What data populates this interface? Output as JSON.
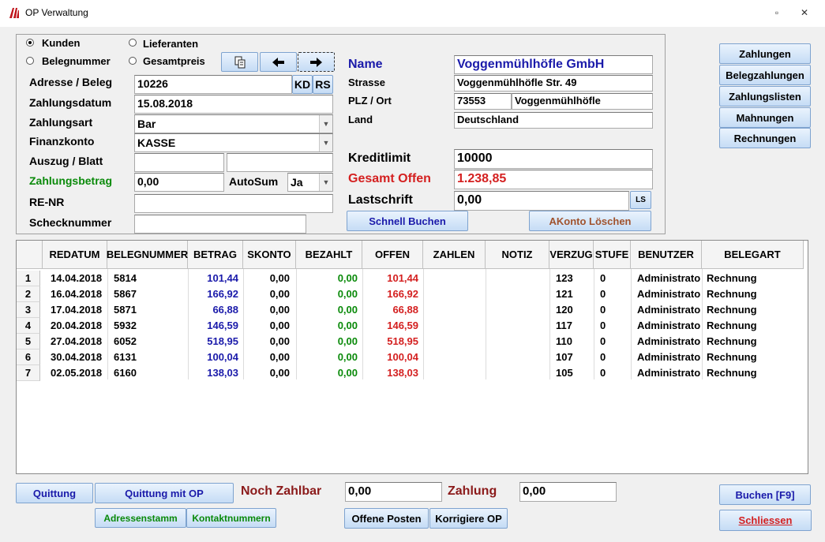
{
  "window": {
    "title": "OP Verwaltung",
    "restore_glyph": "▫",
    "close_glyph": "✕"
  },
  "mode": {
    "kunden": "Kunden",
    "lieferanten": "Lieferanten",
    "belegnummer": "Belegnummer",
    "gesamtpreis": "Gesamtpreis",
    "selected": "Kunden"
  },
  "form": {
    "adresse_label": "Adresse / Beleg",
    "adresse_value": "10226",
    "kd": "KD",
    "rs": "RS",
    "zahlungsdatum_label": "Zahlungsdatum",
    "zahlungsdatum_value": "15.08.2018",
    "zahlungsart_label": "Zahlungsart",
    "zahlungsart_value": "Bar",
    "finanzkonto_label": "Finanzkonto",
    "finanzkonto_value": "KASSE",
    "auszug_label": "Auszug / Blatt",
    "auszug_value": "",
    "blatt_value": "",
    "zahlungsbetrag_label": "Zahlungsbetrag",
    "zahlungsbetrag_value": "0,00",
    "autosum_label": "AutoSum",
    "autosum_value": "Ja",
    "renr_label": "RE-NR",
    "renr_value": "",
    "scheck_label": "Schecknummer",
    "scheck_value": ""
  },
  "address": {
    "name_label": "Name",
    "name_value": "Voggenmühlhöfle GmbH",
    "strasse_label": "Strasse",
    "strasse_value": "Voggenmühlhöfle Str. 49",
    "plz_label": "PLZ / Ort",
    "plz_value": "73553",
    "ort_value": "Voggenmühlhöfle",
    "land_label": "Land",
    "land_value": "Deutschland",
    "kreditlimit_label": "Kreditlimit",
    "kreditlimit_value": "10000",
    "offen_label": "Gesamt Offen",
    "offen_value": "1.238,85",
    "lastschrift_label": "Lastschrift",
    "lastschrift_value": "0,00",
    "ls": "LS",
    "schnell_buchen": "Schnell Buchen",
    "akonto_loeschen": "AKonto Löschen"
  },
  "side_buttons": [
    "Zahlungen",
    "Belegzahlungen",
    "Zahlungslisten",
    "Mahnungen",
    "Rechnungen"
  ],
  "table": {
    "columns": [
      "REDATUM",
      "BELEGNUMMER",
      "BETRAG",
      "SKONTO",
      "BEZAHLT",
      "OFFEN",
      "ZAHLEN",
      "NOTIZ",
      "VERZUG",
      "STUFE",
      "BENUTZER",
      "BELEGART"
    ],
    "rows": [
      [
        "1",
        "14.04.2018",
        "5814",
        "101,44",
        "0,00",
        "0,00",
        "101,44",
        "",
        "",
        "123",
        "0",
        "Administrato",
        "Rechnung"
      ],
      [
        "2",
        "16.04.2018",
        "5867",
        "166,92",
        "0,00",
        "0,00",
        "166,92",
        "",
        "",
        "121",
        "0",
        "Administrato",
        "Rechnung"
      ],
      [
        "3",
        "17.04.2018",
        "5871",
        "66,88",
        "0,00",
        "0,00",
        "66,88",
        "",
        "",
        "120",
        "0",
        "Administrato",
        "Rechnung"
      ],
      [
        "4",
        "20.04.2018",
        "5932",
        "146,59",
        "0,00",
        "0,00",
        "146,59",
        "",
        "",
        "117",
        "0",
        "Administrato",
        "Rechnung"
      ],
      [
        "5",
        "27.04.2018",
        "6052",
        "518,95",
        "0,00",
        "0,00",
        "518,95",
        "",
        "",
        "110",
        "0",
        "Administrato",
        "Rechnung"
      ],
      [
        "6",
        "30.04.2018",
        "6131",
        "100,04",
        "0,00",
        "0,00",
        "100,04",
        "",
        "",
        "107",
        "0",
        "Administrato",
        "Rechnung"
      ],
      [
        "7",
        "02.05.2018",
        "6160",
        "138,03",
        "0,00",
        "0,00",
        "138,03",
        "",
        "",
        "105",
        "0",
        "Administrato",
        "Rechnung"
      ]
    ]
  },
  "bottom": {
    "quittung": "Quittung",
    "quittung_op": "Quittung mit OP",
    "adressenstamm": "Adressenstamm",
    "kontaktnummern": "Kontaktnummern",
    "noch_zahlbar_label": "Noch Zahlbar",
    "noch_zahlbar_value": "0,00",
    "zahlung_label": "Zahlung",
    "zahlung_value": "0,00",
    "offene_posten": "Offene Posten",
    "korrigiere_op": "Korrigiere OP",
    "buchen": "Buchen [F9]",
    "schliessen": "Schliessen"
  },
  "colors": {
    "blue": "#1a1aaa",
    "green": "#0a8a0a",
    "red": "#d42020",
    "darkred": "#8b1a1a",
    "brown": "#a0522d"
  }
}
